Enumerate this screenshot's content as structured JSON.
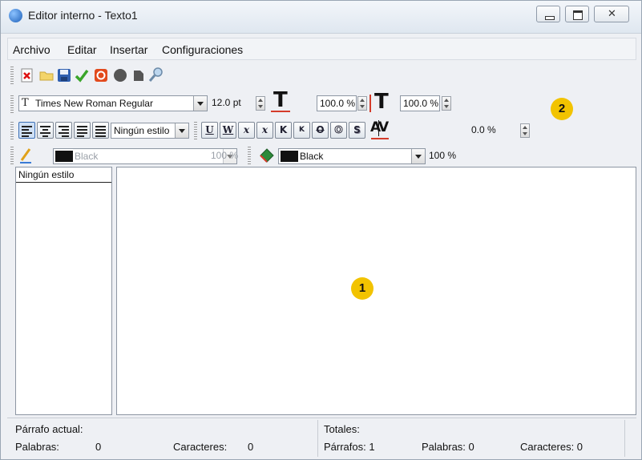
{
  "window": {
    "title": "Editor interno - Texto1"
  },
  "menu": [
    "Archivo",
    "Editar",
    "Insertar",
    "Configuraciones"
  ],
  "font": {
    "name": "Times New Roman Regular",
    "size": "12.0 pt",
    "width_scale": "100.0 %",
    "height_scale": "100.0 %"
  },
  "paragraph": {
    "style": "Ningún estilo",
    "tracking": "0.0 %"
  },
  "format_buttons": [
    {
      "name": "underline",
      "glyph": "U"
    },
    {
      "name": "word-underline",
      "glyph": "W"
    },
    {
      "name": "subscript",
      "glyph": "x"
    },
    {
      "name": "superscript",
      "glyph": "x"
    },
    {
      "name": "all-caps",
      "glyph": "K"
    },
    {
      "name": "small-caps",
      "glyph": "K"
    },
    {
      "name": "strikethrough",
      "glyph": "O"
    },
    {
      "name": "outline",
      "glyph": "O"
    },
    {
      "name": "shadow",
      "glyph": "S"
    }
  ],
  "kerning_glyph": "AV",
  "font_size_glyph": "T",
  "stroke": {
    "color": "Black",
    "tint": "100 %"
  },
  "fill": {
    "color": "Black",
    "tint": "100 %"
  },
  "styles_panel": {
    "header": "Ningún estilo"
  },
  "callouts": [
    "1",
    "2"
  ],
  "status": {
    "current_paragraph_label": "Párrafo actual:",
    "words_label": "Palabras:",
    "words_value": "0",
    "chars_label": "Caracteres:",
    "chars_value": "0",
    "totals_label": "Totales:",
    "total_paragraphs": "Párrafos: 1",
    "total_words": "Palabras: 0",
    "total_chars": "Caracteres: 0"
  },
  "colors": {
    "callout": "#f2c300",
    "active_align": "#cfe0f5"
  },
  "icons": [
    "close-document-icon",
    "open-folder-icon",
    "save-icon",
    "checkmark-icon",
    "stop-icon",
    "circle-icon",
    "shape-icon",
    "search-icon",
    "pencil-icon",
    "paint-bucket-icon"
  ]
}
